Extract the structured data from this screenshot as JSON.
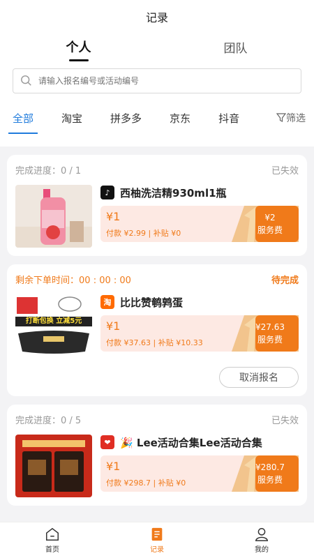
{
  "header": {
    "title": "记录"
  },
  "segments": [
    "个人",
    "团队"
  ],
  "search": {
    "placeholder": "请输入报名编号或活动编号"
  },
  "tabs": [
    "全部",
    "淘宝",
    "拼多多",
    "京东",
    "抖音"
  ],
  "filter_label": "筛选",
  "colors": {
    "accent": "#f07a1a",
    "tab_active": "#1f7bdc",
    "price_bg": "#fde9e3"
  },
  "cards": [
    {
      "progress_label": "完成进度：0 / 1",
      "status": "已失效",
      "platform_icon": "douyin-icon",
      "product_name": "西柚洗洁精930ml1瓶",
      "amount": "¥1",
      "payment": "付款 ¥2.99",
      "subsidy": "补贴 ¥0",
      "fee_amount": "¥2",
      "fee_label": "服务费"
    },
    {
      "countdown_label": "剩余下单时间：",
      "countdown_value": "00 : 00 : 00",
      "status": "待完成",
      "platform_icon": "taobao-icon",
      "product_name": "比比赞鹌鹑蛋",
      "amount": "¥1",
      "payment": "付款 ¥37.63",
      "subsidy": "补贴 ¥10.33",
      "fee_amount": "¥27.63",
      "fee_label": "服务费",
      "cancel_label": "取消报名",
      "thumb_banner": "打断包换 立减5元"
    },
    {
      "progress_label": "完成进度：0 / 5",
      "status": "已失效",
      "platform_icon": "pinduoduo-icon",
      "product_name": "🎉 Lee活动合集Lee活动合集",
      "amount": "¥1",
      "payment": "付款 ¥298.7",
      "subsidy": "补贴 ¥0",
      "fee_amount": "¥280.7",
      "fee_label": "服务费"
    }
  ],
  "bottom_nav": [
    "首页",
    "记录",
    "我的"
  ]
}
